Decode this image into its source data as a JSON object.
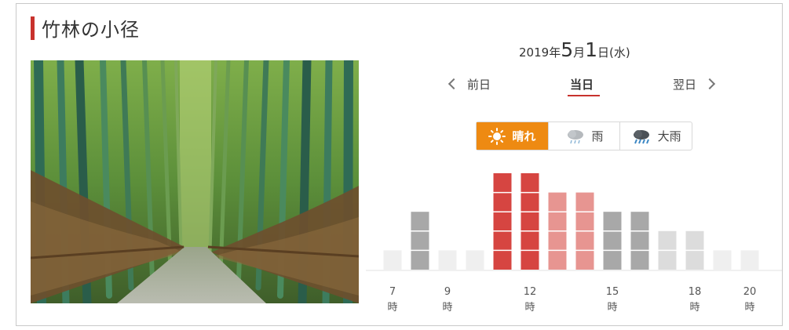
{
  "title": "竹林の小径",
  "date": {
    "year": "2019",
    "year_unit": "年",
    "month": "5",
    "month_unit": "月",
    "day": "1",
    "day_unit": "日",
    "weekday": "(水)"
  },
  "nav": {
    "prev": "前日",
    "today": "当日",
    "next": "翌日"
  },
  "weather_tabs": [
    {
      "label": "晴れ",
      "icon": "sun-icon",
      "active": true
    },
    {
      "label": "雨",
      "icon": "rain-cloud-icon",
      "active": false
    },
    {
      "label": "大雨",
      "icon": "heavy-rain-cloud-icon",
      "active": false
    }
  ],
  "colors": {
    "accent": "#c8322d",
    "active_tab": "#ee8a12",
    "level_high": "#d64541",
    "level_mid": "#e79591",
    "level_gray": "#a8a8a8",
    "level_light": "#dcdcdc",
    "level_low": "#efefef"
  },
  "chart_data": {
    "type": "bar",
    "x": [
      7,
      8,
      9,
      10,
      11,
      12,
      13,
      14,
      15,
      16,
      17,
      18,
      19,
      20
    ],
    "values": [
      1,
      3,
      1,
      1,
      5,
      5,
      4,
      4,
      3,
      3,
      2,
      2,
      1,
      1
    ],
    "levels": [
      "low",
      "gray",
      "low",
      "low",
      "high",
      "high",
      "mid",
      "mid",
      "gray",
      "gray",
      "light",
      "light",
      "low",
      "low"
    ],
    "tick_labels": [
      {
        "hour": 7,
        "num": "7",
        "unit": "時"
      },
      {
        "hour": 9,
        "num": "9",
        "unit": "時"
      },
      {
        "hour": 12,
        "num": "12",
        "unit": "時"
      },
      {
        "hour": 15,
        "num": "15",
        "unit": "時"
      },
      {
        "hour": 18,
        "num": "18",
        "unit": "時"
      },
      {
        "hour": 20,
        "num": "20",
        "unit": "時"
      }
    ],
    "ylim": [
      0,
      5
    ]
  }
}
